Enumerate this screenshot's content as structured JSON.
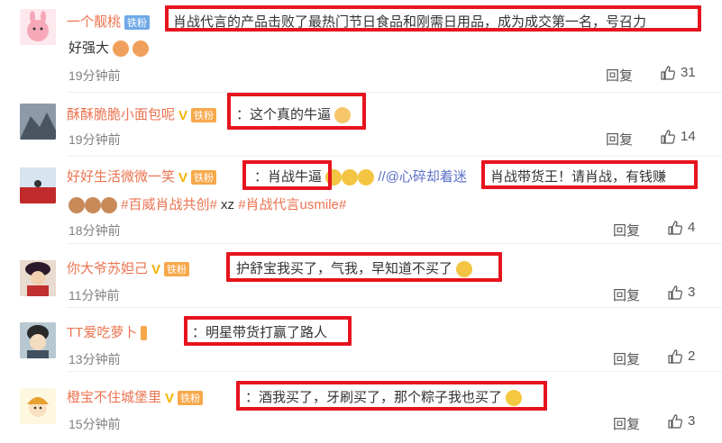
{
  "comments": [
    {
      "user": "一个靓桃",
      "badge": "铁粉",
      "text_line1": "肖战代言的产品击败了最热门节日食品和刚需日用品，成为成交第一名，号召力",
      "text_line2": "好强大",
      "time": "19分钟前",
      "reply": "回复",
      "likes": "31"
    },
    {
      "user": "酥酥脆脆小面包呢",
      "badge": "铁粉",
      "text": "：这个真的牛逼",
      "time": "19分钟前",
      "reply": "回复",
      "likes": "14"
    },
    {
      "user": "好好生活微微一笑",
      "badge": "铁粉",
      "text_a": "：肖战牛逼",
      "text_b": "//@心碎却着迷",
      "text_c": "肖战带货王！请肖战，有钱赚",
      "text_line2_tag1": "#百威肖战共创#",
      "text_line2_mid": "xz",
      "text_line2_tag2": "#肖战代言usmile#",
      "time": "18分钟前",
      "reply": "回复",
      "likes": "4"
    },
    {
      "user": "你大爷苏妲己",
      "badge": "铁粉",
      "text": "护舒宝我买了，气我，早知道不买了",
      "time": "11分钟前",
      "reply": "回复",
      "likes": "3"
    },
    {
      "user": "TT爱吃萝卜",
      "badge": "",
      "text": "：明星带货打赢了路人",
      "time": "13分钟前",
      "reply": "回复",
      "likes": "2"
    },
    {
      "user": "橙宝不住城堡里",
      "badge": "铁粉",
      "text": "：酒我买了，牙刷买了，那个粽子我也买了",
      "time": "15分钟前",
      "reply": "回复",
      "likes": "3"
    }
  ],
  "colors": {
    "username": "#eb7350",
    "highlight_box": "#e6141e",
    "timestamp": "#808080"
  }
}
